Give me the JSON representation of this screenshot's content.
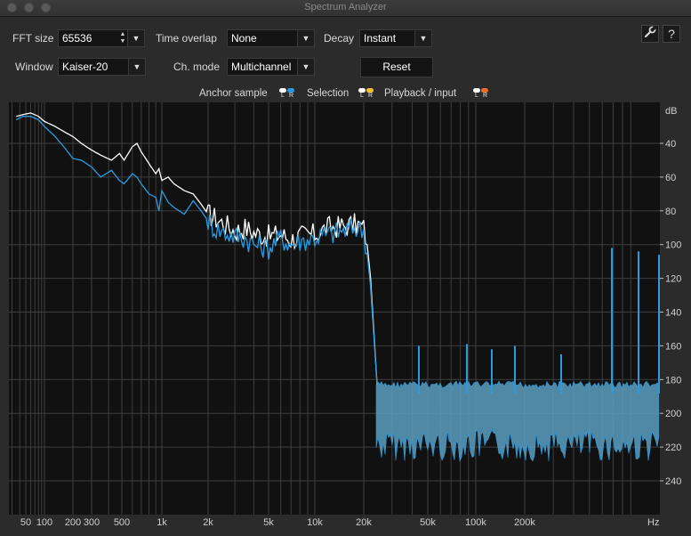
{
  "window": {
    "title": "Spectrum Analyzer"
  },
  "controls": {
    "fft_size": {
      "label": "FFT size",
      "value": "65536",
      "spin_up": "▲",
      "spin_down": "▼",
      "dropdown": "▼"
    },
    "time_overlap": {
      "label": "Time overlap",
      "value": "None",
      "dropdown": "▼"
    },
    "decay": {
      "label": "Decay",
      "value": "Instant",
      "dropdown": "▼"
    },
    "window": {
      "label": "Window",
      "value": "Kaiser-20",
      "dropdown": "▼"
    },
    "ch_mode": {
      "label": "Ch. mode",
      "value": "Multichannel",
      "dropdown": "▼"
    },
    "reset_label": "Reset",
    "settings_icon": "wrench-icon",
    "help_label": "?"
  },
  "legend": {
    "anchor_label": "Anchor sample",
    "selection_label": "Selection",
    "playback_label": "Playback / input",
    "l": "L",
    "r": "R",
    "colors": {
      "anchor_l": "#ffffff",
      "anchor_r": "#2b9be0",
      "selection_l": "#ffffff",
      "selection_r": "#f2c12e",
      "playback_l": "#ffffff",
      "playback_r": "#e8702a"
    }
  },
  "chart_data": {
    "type": "line",
    "x_scale": "log",
    "y_unit": "dB",
    "x_unit": "Hz",
    "xlim": [
      35,
      22050
    ],
    "ylim": [
      -250,
      0
    ],
    "x_ticks": [
      {
        "v": 50,
        "label": "50"
      },
      {
        "v": 100,
        "label": "100"
      },
      {
        "v": 200,
        "label": "200"
      },
      {
        "v": 300,
        "label": "300"
      },
      {
        "v": 500,
        "label": "500"
      },
      {
        "v": 1000,
        "label": "1k"
      },
      {
        "v": 2000,
        "label": "2k"
      },
      {
        "v": 5000,
        "label": "5k"
      },
      {
        "v": 10000,
        "label": "10k"
      },
      {
        "v": 20000,
        "label": "20k"
      },
      {
        "v": 50000,
        "label": "50k"
      },
      {
        "v": 100000,
        "label": "100k"
      },
      {
        "v": 200000,
        "label": "200k"
      }
    ],
    "y_ticks": [
      {
        "v": -40,
        "label": "40"
      },
      {
        "v": -60,
        "label": "60"
      },
      {
        "v": -80,
        "label": "80"
      },
      {
        "v": -100,
        "label": "100"
      },
      {
        "v": -120,
        "label": "120"
      },
      {
        "v": -140,
        "label": "140"
      },
      {
        "v": -160,
        "label": "160"
      },
      {
        "v": -180,
        "label": "180"
      },
      {
        "v": -200,
        "label": "200"
      },
      {
        "v": -220,
        "label": "220"
      },
      {
        "v": -240,
        "label": "240"
      }
    ],
    "grid": true,
    "colors": {
      "background": "#111111",
      "grid": "#3e3e3e",
      "series_l": "#ffffff",
      "series_r": "#2b9be0",
      "fill": "#5a9fc0"
    },
    "series": [
      {
        "channel": "L",
        "points": [
          [
            35,
            -24
          ],
          [
            45,
            -23
          ],
          [
            60,
            -22
          ],
          [
            80,
            -24
          ],
          [
            100,
            -27
          ],
          [
            130,
            -30
          ],
          [
            160,
            -33
          ],
          [
            200,
            -36
          ],
          [
            240,
            -40
          ],
          [
            300,
            -44
          ],
          [
            350,
            -47
          ],
          [
            420,
            -50
          ],
          [
            480,
            -46
          ],
          [
            520,
            -50
          ],
          [
            600,
            -42
          ],
          [
            650,
            -40
          ],
          [
            700,
            -45
          ],
          [
            800,
            -52
          ],
          [
            900,
            -58
          ],
          [
            950,
            -55
          ],
          [
            1000,
            -62
          ],
          [
            1100,
            -60
          ],
          [
            1200,
            -64
          ],
          [
            1400,
            -68
          ],
          [
            1600,
            -70
          ],
          [
            1800,
            -76
          ],
          [
            2000,
            -82
          ],
          [
            2200,
            -84
          ],
          [
            2600,
            -88
          ],
          [
            3000,
            -92
          ],
          [
            3500,
            -90
          ],
          [
            4000,
            -93
          ],
          [
            5000,
            -95
          ],
          [
            6000,
            -94
          ],
          [
            7000,
            -97
          ],
          [
            8000,
            -95
          ],
          [
            10000,
            -94
          ],
          [
            12000,
            -90
          ],
          [
            15000,
            -89
          ],
          [
            18000,
            -88
          ],
          [
            20000,
            -90
          ],
          [
            21000,
            -100
          ],
          [
            22050,
            -120
          ]
        ]
      },
      {
        "channel": "R",
        "points": [
          [
            35,
            -26
          ],
          [
            45,
            -24
          ],
          [
            60,
            -24
          ],
          [
            80,
            -26
          ],
          [
            100,
            -30
          ],
          [
            130,
            -36
          ],
          [
            160,
            -42
          ],
          [
            200,
            -49
          ],
          [
            240,
            -50
          ],
          [
            300,
            -54
          ],
          [
            350,
            -60
          ],
          [
            420,
            -56
          ],
          [
            480,
            -62
          ],
          [
            520,
            -64
          ],
          [
            600,
            -58
          ],
          [
            650,
            -60
          ],
          [
            700,
            -64
          ],
          [
            800,
            -70
          ],
          [
            900,
            -72
          ],
          [
            950,
            -80
          ],
          [
            1000,
            -68
          ],
          [
            1100,
            -75
          ],
          [
            1200,
            -78
          ],
          [
            1400,
            -82
          ],
          [
            1600,
            -74
          ],
          [
            1800,
            -80
          ],
          [
            2000,
            -86
          ],
          [
            2200,
            -90
          ],
          [
            2600,
            -93
          ],
          [
            3000,
            -95
          ],
          [
            3500,
            -96
          ],
          [
            4000,
            -100
          ],
          [
            5000,
            -102
          ],
          [
            6000,
            -96
          ],
          [
            7000,
            -100
          ],
          [
            8000,
            -98
          ],
          [
            10000,
            -96
          ],
          [
            12000,
            -94
          ],
          [
            15000,
            -92
          ],
          [
            18000,
            -90
          ],
          [
            20000,
            -92
          ],
          [
            21000,
            -105
          ],
          [
            22050,
            -125
          ]
        ]
      }
    ],
    "noise_floor": {
      "start_hz": 22500,
      "upper_db": -183,
      "lower_db": -210,
      "peaks": [
        {
          "hz": 33000,
          "db": -160
        },
        {
          "hz": 48000,
          "db": -159
        },
        {
          "hz": 70000,
          "db": -162
        },
        {
          "hz": 100000,
          "db": -160
        },
        {
          "hz": 140000,
          "db": -165
        },
        {
          "hz": 230000,
          "db": -102
        },
        {
          "hz": 360000,
          "db": -104
        },
        {
          "hz": 500000,
          "db": -106
        }
      ]
    }
  }
}
